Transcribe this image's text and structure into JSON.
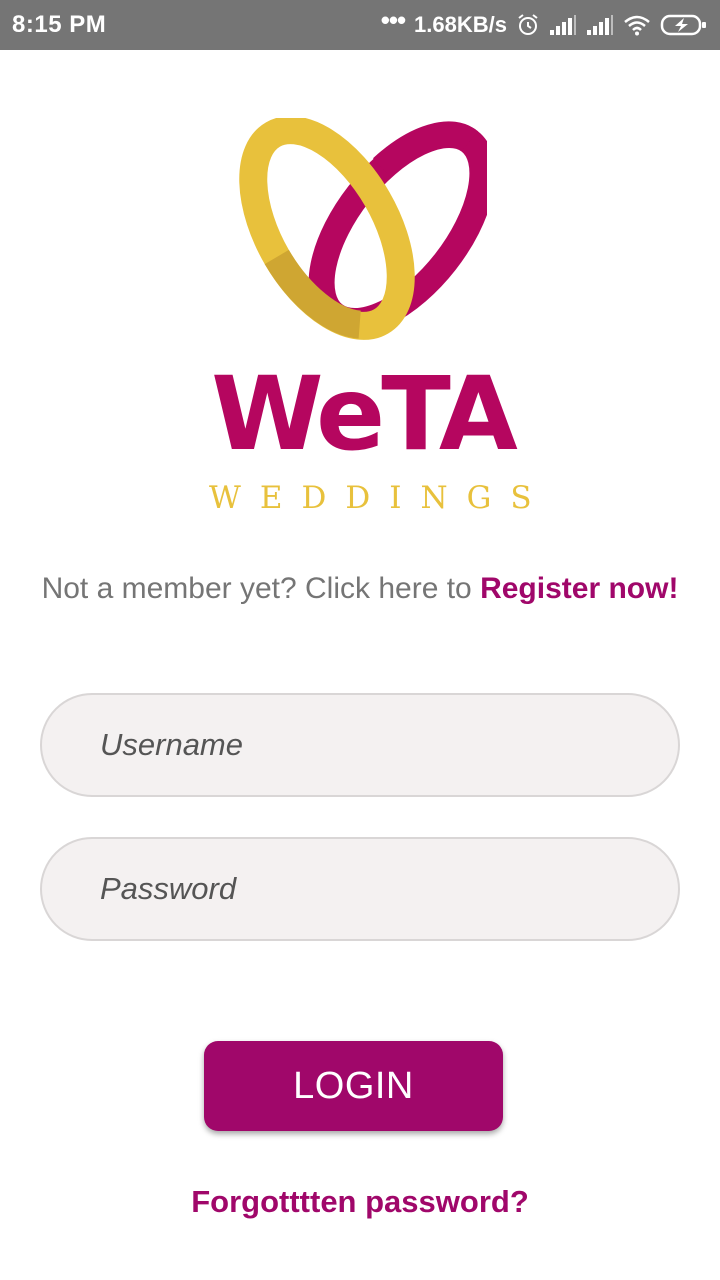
{
  "status_bar": {
    "time": "8:15 PM",
    "dots": "•••",
    "network_speed": "1.68KB/s",
    "icons": [
      "alarm-icon",
      "signal-icon",
      "signal-icon",
      "wifi-icon",
      "battery-charging-icon"
    ]
  },
  "logo": {
    "name": "WeTA",
    "tagline": "WEDDINGS",
    "colors": {
      "magenta": "#b5065f",
      "gold": "#e8c13c"
    }
  },
  "register": {
    "prompt": "Not a member yet? Click here to",
    "link_label": "Register now!"
  },
  "form": {
    "username_placeholder": "Username",
    "password_placeholder": "Password",
    "username_value": "",
    "password_value": ""
  },
  "actions": {
    "login_label": "LOGIN",
    "forgot_label": "Forgotttten password?"
  },
  "colors": {
    "accent": "#a0076a",
    "status_bar": "#757575",
    "field_bg": "#f4f1f1",
    "muted_text": "#757575"
  }
}
